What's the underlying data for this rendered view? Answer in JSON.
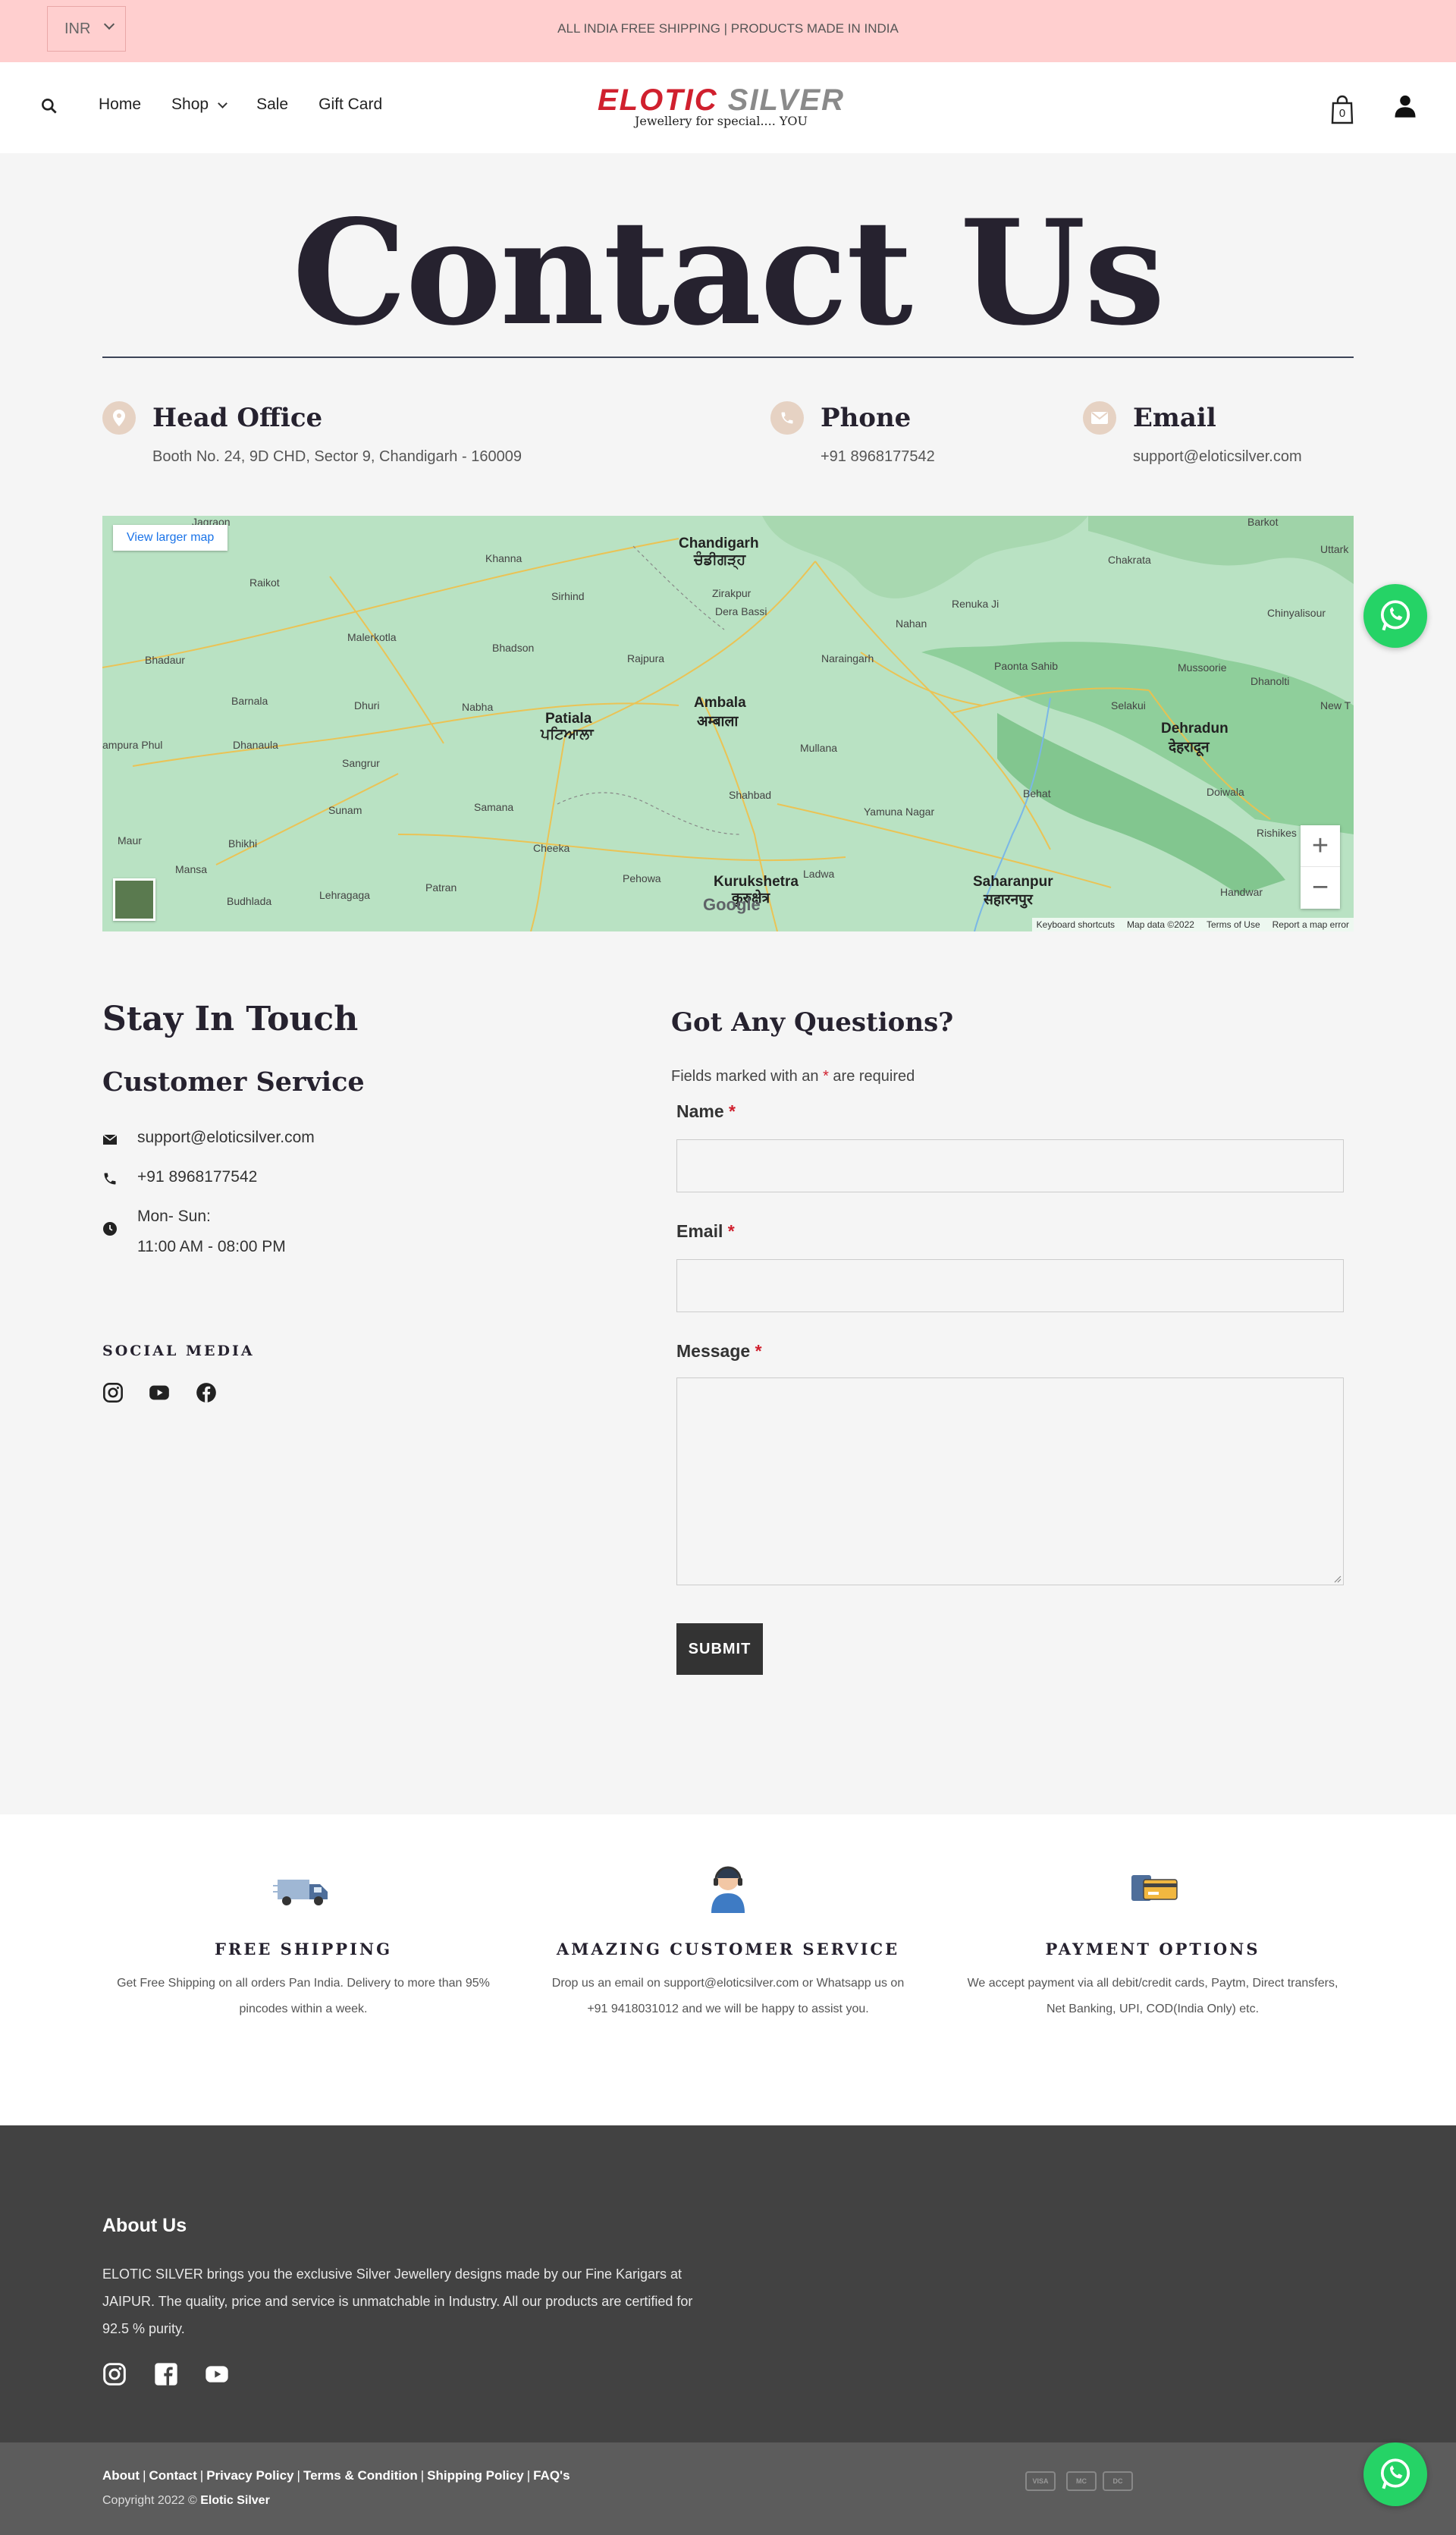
{
  "topbar": {
    "currency": "INR",
    "announcement": "ALL INDIA FREE SHIPPING | PRODUCTS MADE IN INDIA"
  },
  "header": {
    "nav": [
      "Home",
      "Shop",
      "Sale",
      "Gift Card"
    ],
    "logo": {
      "part1": "ELOTIC",
      "part2": "SILVER",
      "tagline": "Jewellery for special.... YOU"
    },
    "cart_count": "0"
  },
  "page": {
    "title": "Contact Us"
  },
  "info": {
    "office": {
      "title": "Head Office",
      "text": "Booth No. 24, 9D CHD, Sector 9, Chandigarh - 160009"
    },
    "phone": {
      "title": "Phone",
      "text": "+91 8968177542"
    },
    "email": {
      "title": "Email",
      "text": "support@eloticsilver.com"
    }
  },
  "map": {
    "larger_link": "View larger map",
    "google": "Google",
    "footer": [
      "Keyboard shortcuts",
      "Map data ©2022",
      "Terms of Use",
      "Report a map error"
    ],
    "labels": {
      "chandigarh": "Chandigarh",
      "chandigarh_pa": "ਚੰਡੀਗੜ੍ਹ",
      "patiala": "Patiala",
      "patiala_pa": "ਪਟਿਆਲਾ",
      "ambala": "Ambala",
      "ambala_hi": "अम्बाला",
      "dehradun": "Dehradun",
      "dehradun_hi": "देहरादून",
      "kurukshetra": "Kurukshetra",
      "kurukshetra_hi": "कुरुक्षेत्र",
      "saharanpur": "Saharanpur",
      "saharanpur_hi": "सहारनपुर",
      "khanna": "Khanna",
      "raikot": "Raikot",
      "malerkotla": "Malerkotla",
      "nabha": "Nabha",
      "sangrur": "Sangrur",
      "samana": "Samana",
      "rajpura": "Rajpura",
      "shahbad": "Shahbad",
      "yamuna_nagar": "Yamuna Nagar",
      "mussoorie": "Mussoorie",
      "rishikesh": "Rishikes",
      "barnala": "Barnala",
      "bhadaur": "Bhadaur",
      "jagraon": "Jagraon",
      "sirhind": "Sirhind",
      "bhadson": "Bhadson",
      "dhuri": "Dhuri",
      "sunam": "Sunam",
      "mansa": "Mansa",
      "budhlada": "Budhlada",
      "lehragaga": "Lehragaga",
      "patran": "Patran",
      "cheeka": "Cheeka",
      "pehowa": "Pehowa",
      "ladwa": "Ladwa",
      "behat": "Behat",
      "doiwala": "Doiwala",
      "handwar": "Handwar",
      "nahan": "Nahan",
      "naraingarh": "Naraingarh",
      "mullana": "Mullana",
      "paonta_sahib": "Paonta Sahib",
      "selakui": "Selakui",
      "chakrata": "Chakrata",
      "chinyalisour": "Chinyalisour",
      "renuka_ji": "Renuka Ji",
      "zirakpur": "Zirakpur",
      "dera_bassi": "Dera Bassi",
      "dhanaula": "Dhanaula",
      "rampura_phul": "ampura Phul",
      "maur": "Maur",
      "bhikhi": "Bhikhi",
      "dhanolti": "Dhanolti",
      "barkot": "Barkot",
      "uttark": "Uttark",
      "new_t": "New T"
    }
  },
  "touch": {
    "heading": "Stay In Touch",
    "subheading": "Customer Service",
    "email": "support@eloticsilver.com",
    "phone": "+91 8968177542",
    "hours_days": "Mon- Sun:",
    "hours_time": "11:00 AM - 08:00 PM",
    "social_heading": "SOCIAL MEDIA"
  },
  "form": {
    "heading": "Got Any Questions?",
    "note_before": "Fields marked with an ",
    "note_star": "*",
    "note_after": " are required",
    "name_label": "Name",
    "email_label": "Email",
    "message_label": "Message",
    "required_mark": "*",
    "submit": "SUBMIT"
  },
  "features": [
    {
      "title": "FREE SHIPPING",
      "line1": "Get Free Shipping on all orders Pan India. Delivery to more than 95%",
      "line2": "pincodes within a week.",
      "icon": "truck-icon"
    },
    {
      "title": "AMAZING CUSTOMER SERVICE",
      "line1": "Drop us an email on support@eloticsilver.com or Whatsapp us on",
      "line2": "+91 9418031012 and we will be happy to assist you.",
      "icon": "support-agent-icon"
    },
    {
      "title": "PAYMENT OPTIONS",
      "line1": "We accept payment via all debit/credit cards, Paytm, Direct transfers,",
      "line2": "Net Banking, UPI, COD(India Only) etc.",
      "icon": "payment-icon"
    }
  ],
  "footer": {
    "about_heading": "About Us",
    "about_line1": "ELOTIC SILVER brings you the exclusive Silver Jewellery designs made by our Fine Karigars at",
    "about_line2": "JAIPUR. The quality, price and service is unmatchable in Industry. All our products are certified for",
    "about_line3": "92.5 % purity.",
    "links": [
      "About",
      "Contact",
      "Privacy Policy",
      "Terms & Condition",
      "Shipping Policy",
      "FAQ's"
    ],
    "separator": "|",
    "copyright": "Copyright 2022 © ",
    "brand": "Elotic Silver",
    "payments": [
      "VISA",
      "MC",
      "DC"
    ]
  },
  "colors": {
    "topbar": "#ffcfcf",
    "title": "#26222f",
    "accent_red": "#d0202e",
    "whatsapp": "#25d366",
    "footer": "#424242",
    "footer_bottom": "#5c5c5c"
  }
}
